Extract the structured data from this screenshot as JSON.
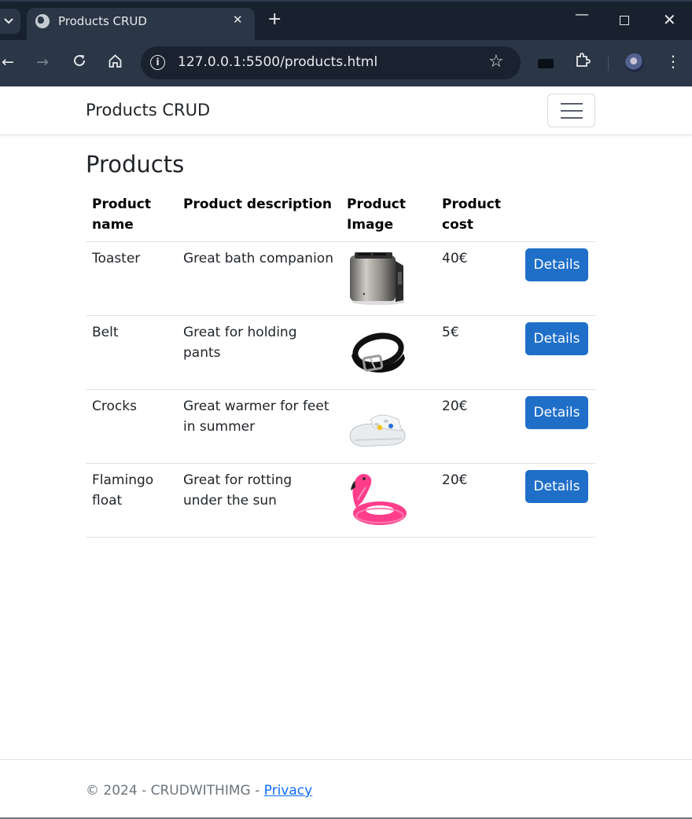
{
  "browser": {
    "tab_title": "Products CRUD",
    "tab_close": "✕",
    "new_tab": "+",
    "url": "127.0.0.1:5500/products.html"
  },
  "navbar": {
    "brand": "Products CRUD"
  },
  "page": {
    "heading": "Products",
    "columns": [
      "Product name",
      "Product description",
      "Product Image",
      "Product cost"
    ],
    "products": [
      {
        "name": "Toaster",
        "description": "Great bath companion",
        "image": "toaster",
        "cost": "40€",
        "action": "Details"
      },
      {
        "name": "Belt",
        "description": "Great for holding pants",
        "image": "belt",
        "cost": "5€",
        "action": "Details"
      },
      {
        "name": "Crocks",
        "description": "Great warmer for feet in summer",
        "image": "crocs",
        "cost": "20€",
        "action": "Details"
      },
      {
        "name": "Flamingo float",
        "description": "Great for rotting under the sun",
        "image": "flamingo-float",
        "cost": "20€",
        "action": "Details"
      }
    ]
  },
  "footer": {
    "copyright": "© 2024 - CRUDWITHIMG - ",
    "privacy_link": "Privacy"
  },
  "colors": {
    "primary_button": "#1f6fc9",
    "browser_frame": "#18212e",
    "browser_toolbar": "#2b3646"
  }
}
